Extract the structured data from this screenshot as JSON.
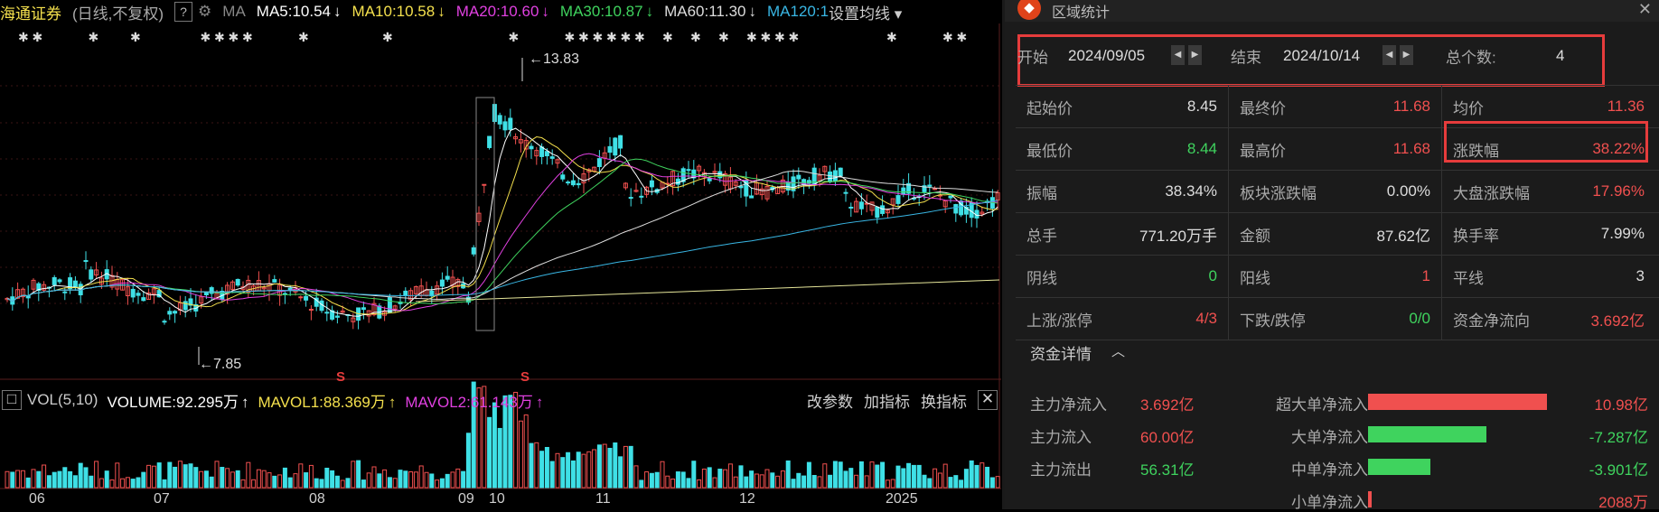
{
  "chart_header": {
    "stock_name": "海通证券",
    "mode": "(日线,不复权)",
    "help": "?",
    "gear": "gear-icon",
    "ma": "MA",
    "ma5": "MA5:10.54",
    "ma10": "MA10:10.58",
    "ma20": "MA20:10.60",
    "ma30": "MA30:10.87",
    "ma60": "MA60:11.30",
    "ma120": "MA120:1",
    "settings": "设置均线",
    "down_arrow": "↓"
  },
  "volume_header": {
    "vol": "VOL(5,10)",
    "volume": "VOLUME:92.295万",
    "mavol1": "MAVOL1:88.369万",
    "mavol2": "MAVOL2:61.143万",
    "up_arrow": "↑",
    "adjust": "改参数",
    "add": "加指标",
    "swap": "换指标",
    "close": "✕"
  },
  "markers": {
    "high": "13.83",
    "low": "7.85",
    "s": "S"
  },
  "x_axis": [
    "06",
    "07",
    "08",
    "09",
    "10",
    "11",
    "12",
    "2025"
  ],
  "colors": {
    "ma5": "#ffffff",
    "ma10": "#f4e04d",
    "ma20": "#e040e0",
    "ma30": "#3fd35e",
    "ma60": "#dddddd",
    "ma120": "#39b6e4",
    "up": "#f0504f",
    "down": "#3fe0e6",
    "highlight": "#e63c3c"
  },
  "panel": {
    "title": "区域统计",
    "close": "✕",
    "start_label": "开始",
    "start": "2024/09/05",
    "end_label": "结束",
    "end": "2024/10/14",
    "count_label": "总个数:",
    "count": "4",
    "rows": [
      [
        {
          "l": "起始价",
          "v": "8.45",
          "c": "white"
        },
        {
          "l": "最终价",
          "v": "11.68",
          "c": "red"
        },
        {
          "l": "均价",
          "v": "11.36",
          "c": "red"
        }
      ],
      [
        {
          "l": "最低价",
          "v": "8.44",
          "c": "green"
        },
        {
          "l": "最高价",
          "v": "11.68",
          "c": "red"
        },
        {
          "l": "涨跌幅",
          "v": "38.22%",
          "c": "red"
        }
      ],
      [
        {
          "l": "振幅",
          "v": "38.34%",
          "c": "white"
        },
        {
          "l": "板块涨跌幅",
          "v": "0.00%",
          "c": "white"
        },
        {
          "l": "大盘涨跌幅",
          "v": "17.96%",
          "c": "red"
        }
      ],
      [
        {
          "l": "总手",
          "v": "771.20万手",
          "c": "white"
        },
        {
          "l": "金额",
          "v": "87.62亿",
          "c": "white"
        },
        {
          "l": "换手率",
          "v": "7.99%",
          "c": "white"
        }
      ],
      [
        {
          "l": "阴线",
          "v": "0",
          "c": "green"
        },
        {
          "l": "阳线",
          "v": "1",
          "c": "red"
        },
        {
          "l": "平线",
          "v": "3",
          "c": "white"
        }
      ],
      [
        {
          "l": "上涨/涨停",
          "v": "4/3",
          "c": "red"
        },
        {
          "l": "下跌/跌停",
          "v": "0/0",
          "c": "green"
        },
        {
          "l": "资金净流向",
          "v": "3.692亿",
          "c": "red"
        }
      ]
    ],
    "flow_title": "资金详情",
    "flow_caret": "︿",
    "flow_left": [
      {
        "l": "主力净流入",
        "v": "3.692亿",
        "c": "red"
      },
      {
        "l": "主力流入",
        "v": "60.00亿",
        "c": "red"
      },
      {
        "l": "主力流出",
        "v": "56.31亿",
        "c": "green"
      }
    ],
    "flow_right": [
      {
        "l": "超大单净流入",
        "v": "10.98亿",
        "c": "red",
        "ratio": 1.0
      },
      {
        "l": "大单净流入",
        "v": "-7.287亿",
        "c": "green",
        "ratio": 0.66
      },
      {
        "l": "中单净流入",
        "v": "-3.901亿",
        "c": "green",
        "ratio": 0.35
      },
      {
        "l": "小单净流入",
        "v": "2088万",
        "c": "red",
        "ratio": 0.02
      }
    ]
  }
}
